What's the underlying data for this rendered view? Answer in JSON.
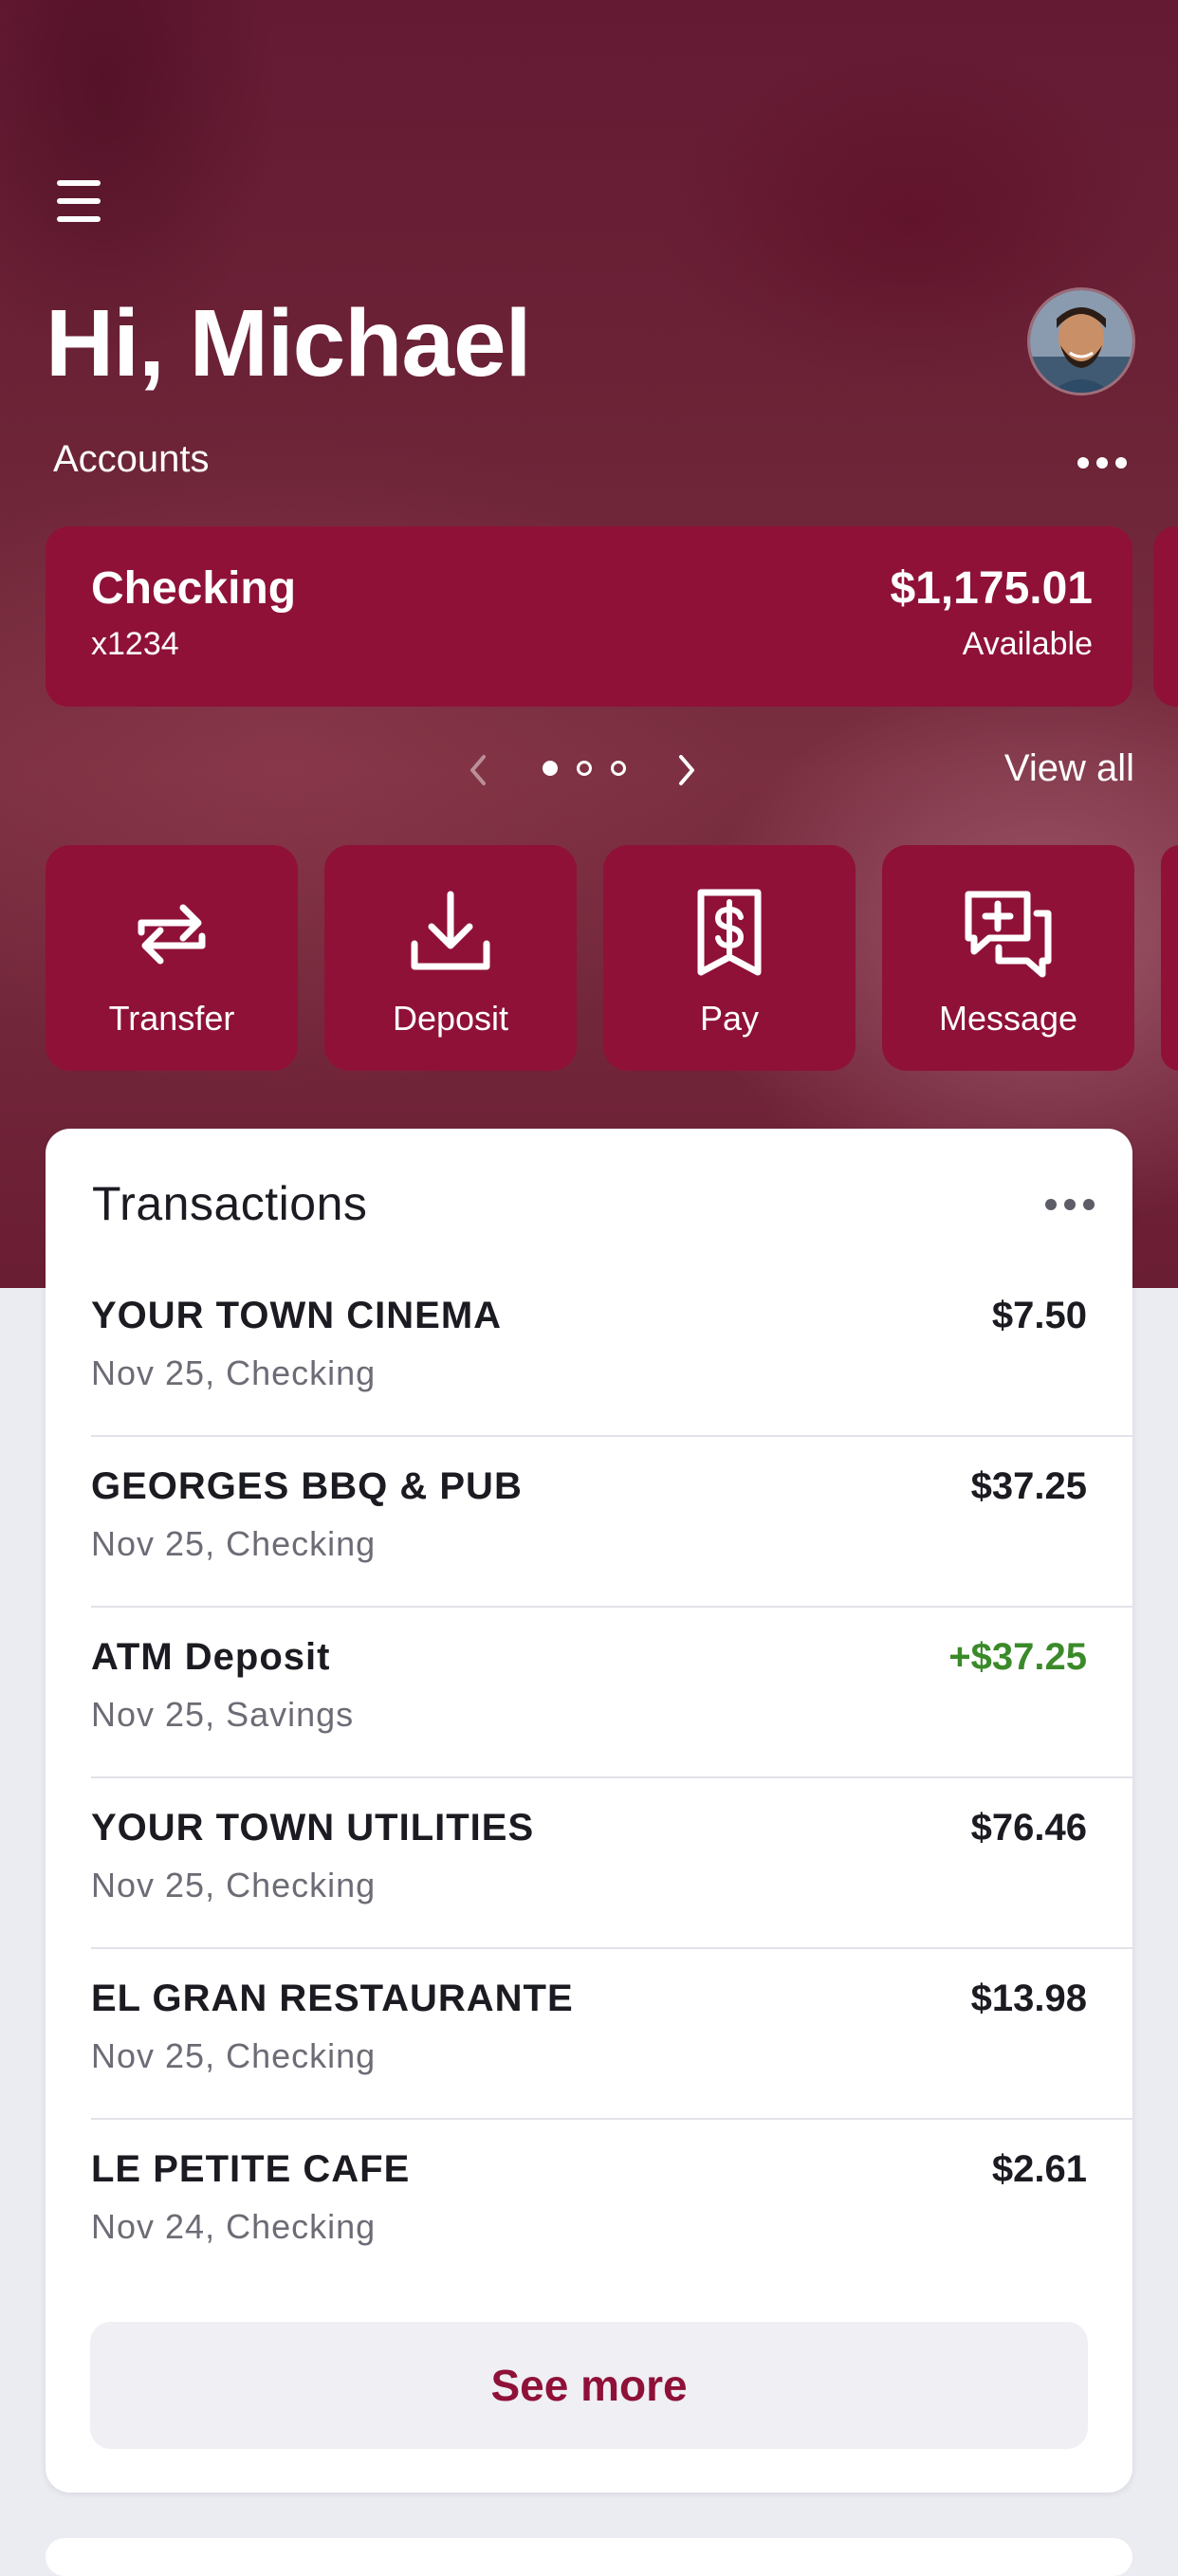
{
  "header": {
    "greeting": "Hi, Michael",
    "accounts_label": "Accounts"
  },
  "account": {
    "name": "Checking",
    "number": "x1234",
    "balance": "$1,175.01",
    "balance_caption": "Available"
  },
  "carousel": {
    "page_count": 3,
    "current_page": 1,
    "view_all_label": "View all"
  },
  "actions": [
    {
      "label": "Transfer",
      "icon": "transfer-arrows-icon"
    },
    {
      "label": "Deposit",
      "icon": "download-tray-icon"
    },
    {
      "label": "Pay",
      "icon": "dollar-receipt-icon"
    },
    {
      "label": "Message",
      "icon": "chat-plus-icon"
    }
  ],
  "transactions": {
    "title": "Transactions",
    "rows": [
      {
        "name": "YOUR TOWN CINEMA",
        "meta": "Nov 25, Checking",
        "amount": "$7.50",
        "credit": false
      },
      {
        "name": "GEORGES BBQ & PUB",
        "meta": "Nov 25, Checking",
        "amount": "$37.25",
        "credit": false
      },
      {
        "name": "ATM Deposit",
        "meta": "Nov 25, Savings",
        "amount": "+$37.25",
        "credit": true
      },
      {
        "name": "YOUR TOWN UTILITIES",
        "meta": "Nov 25, Checking",
        "amount": "$76.46",
        "credit": false
      },
      {
        "name": "EL GRAN RESTAURANTE",
        "meta": "Nov 25, Checking",
        "amount": "$13.98",
        "credit": false
      },
      {
        "name": "LE PETITE CAFE",
        "meta": "Nov 24, Checking",
        "amount": "$2.61",
        "credit": false
      }
    ],
    "see_more_label": "See more"
  },
  "colors": {
    "brand": "#8f1138",
    "credit": "#3b8a2a"
  }
}
